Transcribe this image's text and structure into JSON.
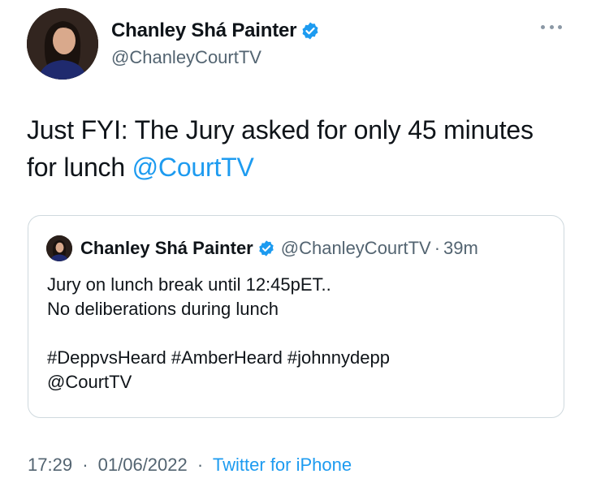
{
  "author": {
    "display_name": "Chanley Shá Painter",
    "handle": "@ChanleyCourtTV"
  },
  "tweet": {
    "text_part1": "Just FYI: The Jury asked for only 45 minutes for lunch ",
    "mention": "@CourtTV"
  },
  "quoted_tweet": {
    "display_name": "Chanley Shá Painter",
    "handle": "@ChanleyCourtTV",
    "separator": "·",
    "time_ago": "39m",
    "lines": [
      "Jury on lunch break until 12:45pET..",
      "No deliberations during lunch",
      "",
      "#DeppvsHeard #AmberHeard #johnnydepp",
      "@CourtTV"
    ]
  },
  "meta": {
    "time": "17:29",
    "separator": "·",
    "date": "01/06/2022",
    "source": "Twitter for iPhone"
  },
  "colors": {
    "accent": "#1d9bf0",
    "text": "#0f1419",
    "secondary": "#536471",
    "border": "#cfd9de"
  },
  "icons": {
    "verified": "verified-badge-icon",
    "more": "more-horizontal-icon"
  }
}
